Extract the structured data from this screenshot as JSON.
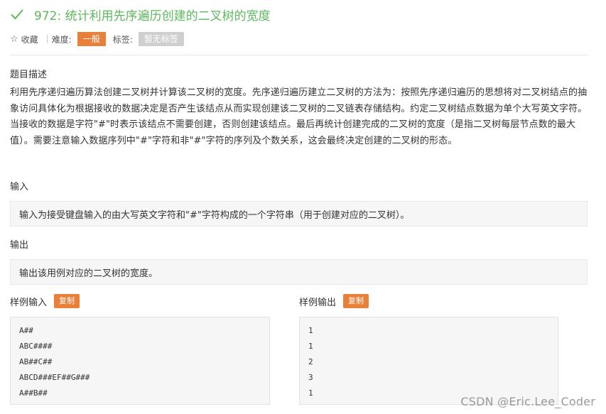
{
  "problem": {
    "title": "972: 统计利用先序遍历创建的二叉树的宽度",
    "status_icon": "check-icon",
    "accent_color": "#5cb85c"
  },
  "meta": {
    "favorite_label": "收藏",
    "difficulty_label": "难度:",
    "difficulty_value": "一般",
    "tags_label": "标签:",
    "tags_value": "暂无标签"
  },
  "description": {
    "heading": "题目描述",
    "text": "利用先序递归遍历算法创建二叉树并计算该二叉树的宽度。先序递归遍历建立二叉树的方法为：按照先序递归遍历的思想将对二叉树结点的抽象访问具体化为根据接收的数据决定是否产生该结点从而实现创建该二叉树的二叉链表存储结构。约定二叉树结点数据为单个大写英文字符。当接收的数据是字符\"#\"时表示该结点不需要创建，否则创建该结点。最后再统计创建完成的二叉树的宽度（是指二叉树每层节点数的最大值）。需要注意输入数据序列中\"#\"字符和非\"#\"字符的序列及个数关系，这会最终决定创建的二叉树的形态。"
  },
  "input": {
    "heading": "输入",
    "text": "输入为接受键盘输入的由大写英文字符和\"#\"字符构成的一个字符串（用于创建对应的二叉树）。"
  },
  "output": {
    "heading": "输出",
    "text": "输出该用例对应的二叉树的宽度。"
  },
  "sample_input": {
    "heading": "样例输入",
    "copy_label": "复制",
    "lines": [
      "A##",
      "ABC####",
      "AB##C##",
      "ABCD###EF##G###",
      "A##B##"
    ]
  },
  "sample_output": {
    "heading": "样例输出",
    "copy_label": "复制",
    "lines": [
      "1",
      "1",
      "2",
      "3",
      "1"
    ]
  },
  "watermark": "CSDN @Eric.Lee_Coder"
}
